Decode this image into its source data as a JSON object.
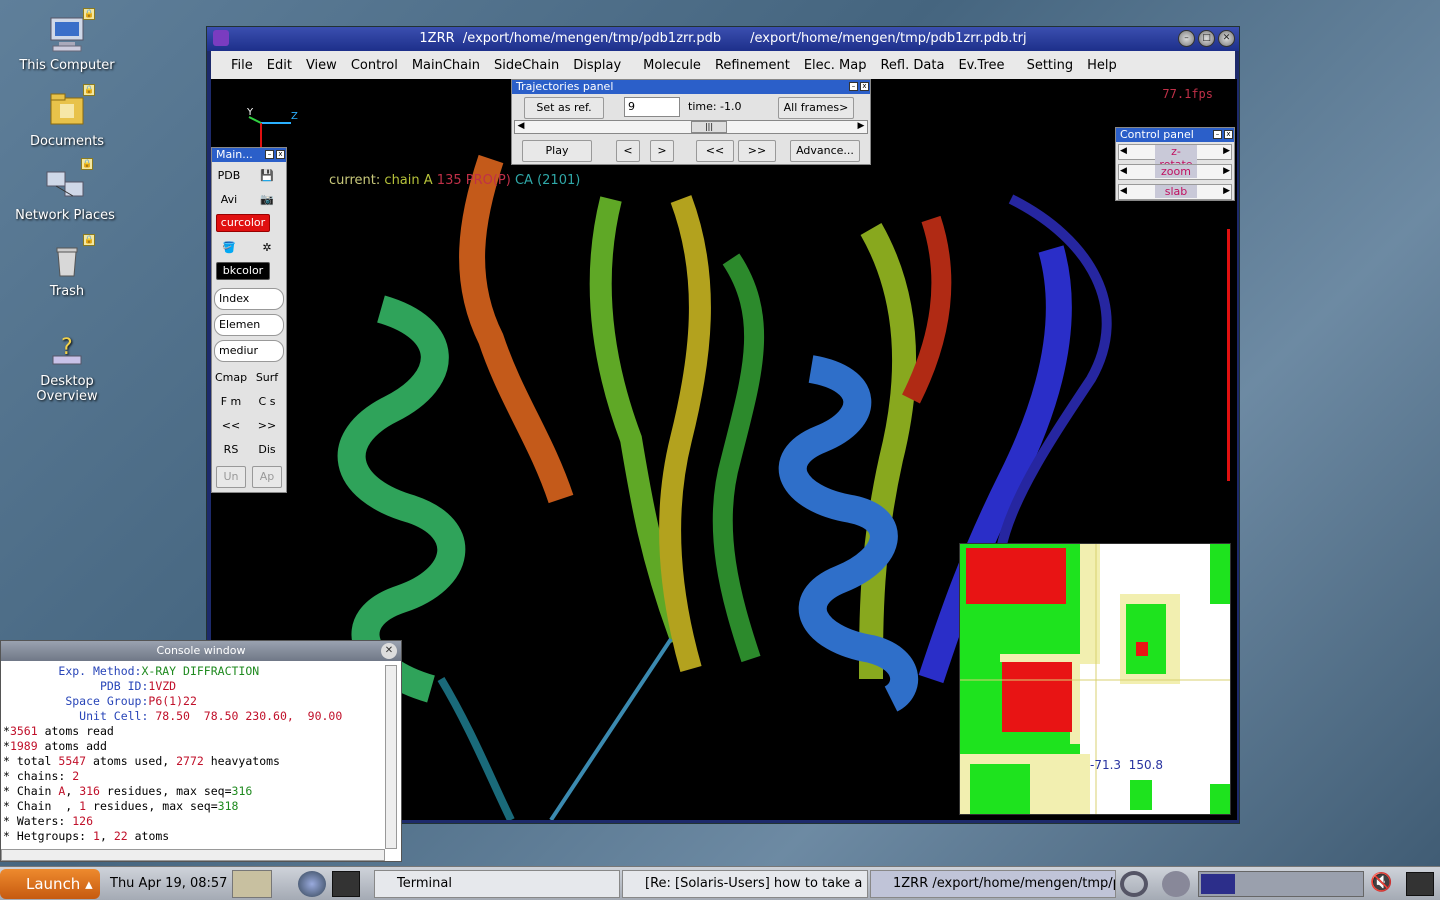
{
  "desktop": {
    "icons": [
      {
        "label": "This Computer"
      },
      {
        "label": "Documents"
      },
      {
        "label": "Network Places"
      },
      {
        "label": "Trash"
      },
      {
        "label": "Desktop\nOverview"
      }
    ]
  },
  "window": {
    "title": "1ZRR  /export/home/mengen/tmp/pdb1zrr.pdb       /export/home/mengen/tmp/pdb1zrr.pdb.trj",
    "menu": [
      "File",
      "Edit",
      "View",
      "Control",
      "MainChain",
      "SideChain",
      "Display",
      "Molecule",
      "Refinement",
      "Elec. Map",
      "Refl. Data",
      "Ev.Tree",
      "Setting",
      "Help"
    ]
  },
  "viewport": {
    "fps": "77.1fps",
    "current_prefix": "current:",
    "current_chain": "chain A",
    "current_res": "135 PRO(P)",
    "current_atom": "CA (2101)",
    "axis_y": "Y",
    "axis_z": "Z"
  },
  "trajectories": {
    "title": "Trajectories panel",
    "set_ref": "Set as ref.",
    "frame_value": "9",
    "time": "time: -1.0",
    "all_frames": "All frames>",
    "play": "Play",
    "prev": "<",
    "next": ">",
    "rewind": "<<",
    "ffwd": ">>",
    "advance": "Advance..."
  },
  "main_panel": {
    "title": "Main...",
    "pdb": "PDB",
    "avi": "Avi",
    "curcolor": "curcolor",
    "bkcolor": "bkcolor",
    "index": "Index",
    "element": "Elemen",
    "medium": "mediur",
    "cmap": "Cmap",
    "surf": "Surf",
    "fm": "F m",
    "cs": "C s",
    "back": "<<",
    "fwd": ">>",
    "rs": "RS",
    "dis": "Dis",
    "un": "Un",
    "ap": "Ap"
  },
  "control_panel": {
    "title": "Control panel",
    "items": [
      "z-rotate",
      "zoom",
      "slab"
    ]
  },
  "ramachandran": {
    "readout": "-71.3  150.8"
  },
  "console": {
    "title": "Console window"
  },
  "taskbar": {
    "launch": "Launch",
    "clock": "Thu Apr 19, 08:57",
    "tasks": [
      "Terminal",
      "[Re: [Solaris-Users] how to take a s",
      "1ZRR  /export/home/mengen/tmp/p"
    ]
  }
}
